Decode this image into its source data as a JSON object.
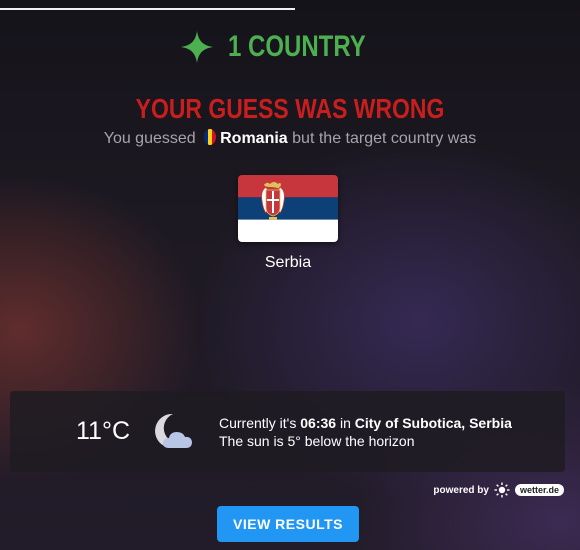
{
  "header": {
    "title": "1 COUNTRY"
  },
  "result": {
    "heading": "YOUR GUESS WAS WRONG",
    "guess_prefix": "You guessed",
    "guessed_country": "Romania",
    "guess_suffix": "but the target country was"
  },
  "target": {
    "country": "Serbia",
    "flag_colors": [
      "#c6363c",
      "#0c4076",
      "#ffffff"
    ]
  },
  "weather": {
    "temperature": "11°C",
    "icon": "moon-cloud-icon",
    "currently_prefix": "Currently it's",
    "time": "06:36",
    "in_word": "in",
    "location": "City of Subotica, Serbia",
    "sun_text": "The sun is 5° below the horizon",
    "powered_by": "powered by",
    "provider": "wetter.de"
  },
  "actions": {
    "view_results": "VIEW RESULTS"
  },
  "colors": {
    "accent_green": "#4caf50",
    "wrong_red": "#c81e1e",
    "button_blue": "#2196f3"
  }
}
